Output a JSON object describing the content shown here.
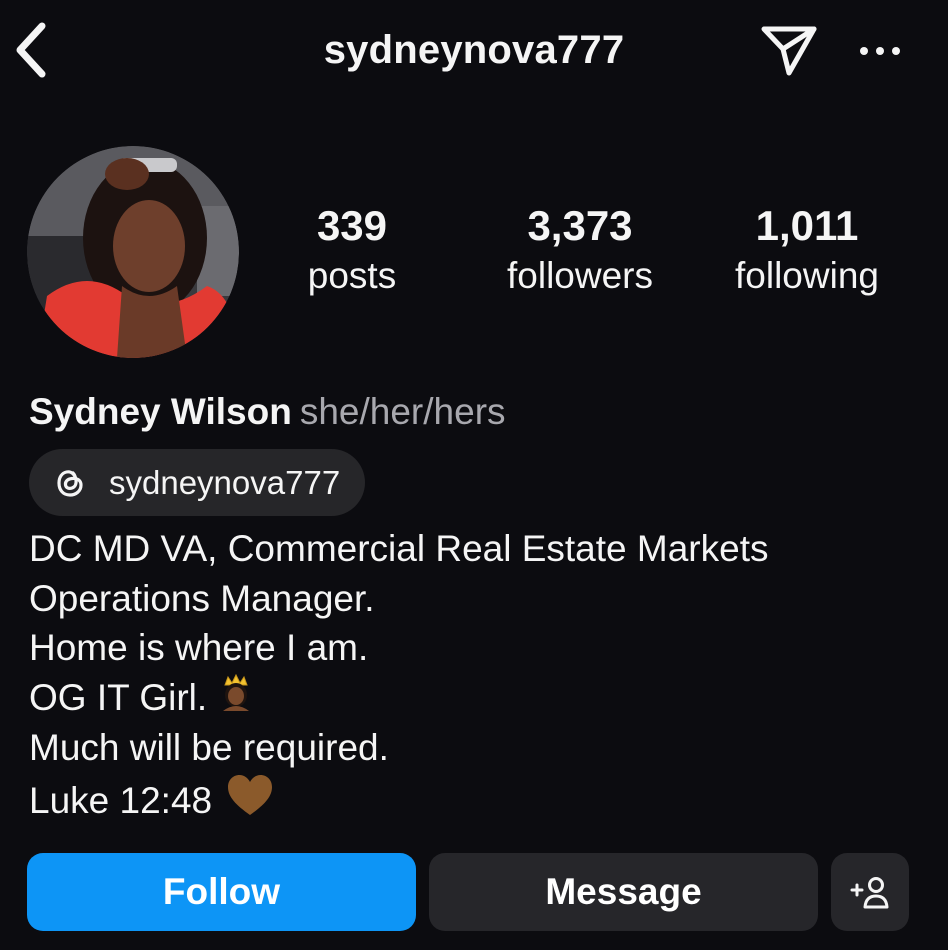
{
  "header": {
    "username": "sydneynova777",
    "back_icon": "chevron-left-icon",
    "send_icon": "paper-plane-icon",
    "more_icon": "ellipsis-icon"
  },
  "profile": {
    "avatar_alt": "profile photo",
    "stats": {
      "posts_count": "339",
      "posts_label": "posts",
      "followers_count": "3,373",
      "followers_label": "followers",
      "following_count": "1,011",
      "following_label": "following"
    },
    "name": "Sydney Wilson",
    "pronouns": "she/her/hers",
    "threads_handle": "sydneynova777",
    "bio_lines": [
      "DC MD VA, Commercial Real Estate Markets",
      "Operations Manager.",
      "Home is where I am.",
      "OG IT Girl.",
      "Much will be required.",
      "Luke 12:48"
    ]
  },
  "actions": {
    "follow_label": "Follow",
    "message_label": "Message",
    "suggest_icon": "add-person-icon"
  },
  "colors": {
    "background": "#0c0c10",
    "primary": "#0d95f6",
    "secondary_button": "#26262a",
    "muted_text": "#a8a8ae"
  }
}
